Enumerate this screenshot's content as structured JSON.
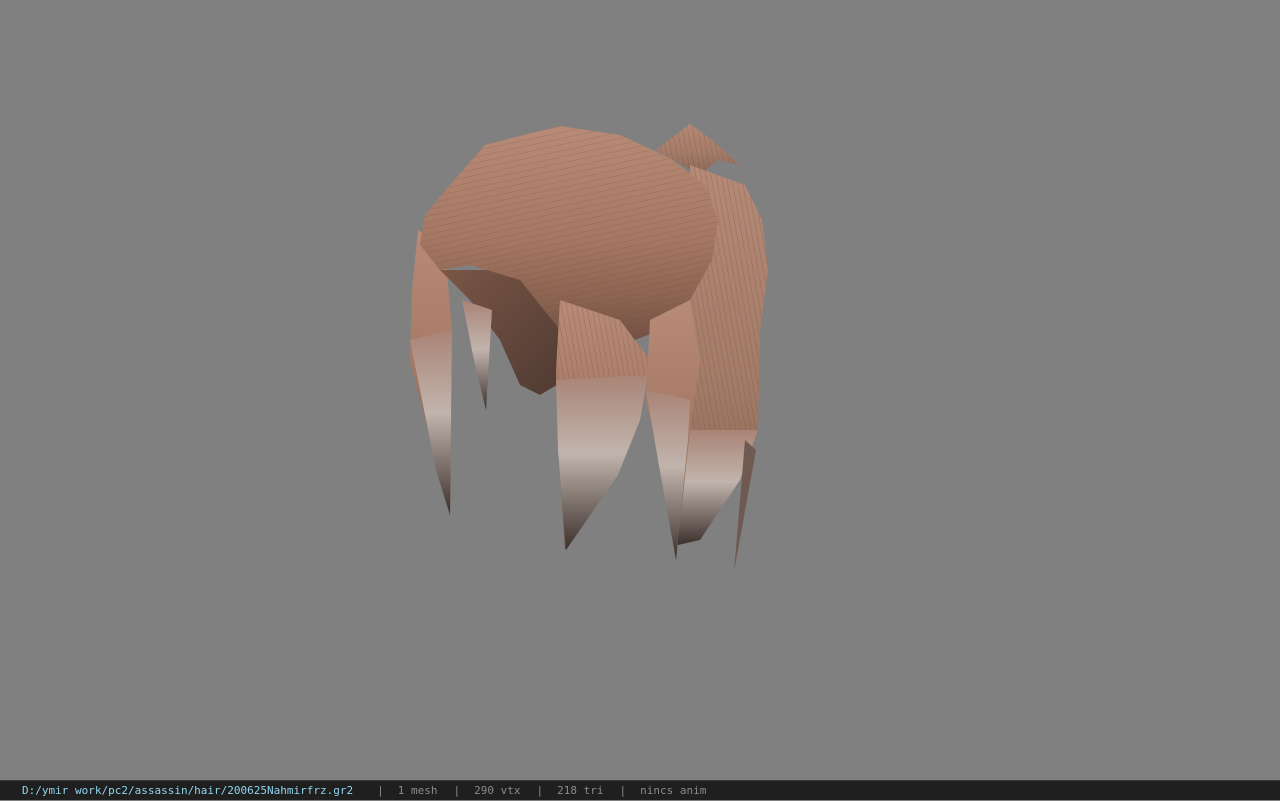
{
  "viewer": {
    "background_color": "#808080",
    "model": "hair-mesh",
    "hair_base_color": "#a57864",
    "hair_tip_color": "#b8aca6"
  },
  "statusbar": {
    "file_path": "D:/ymir work/pc2/assassin/hair/200625Nahmirfrz.gr2",
    "separator": "|",
    "mesh_count": "1 mesh",
    "vertex_count": "290 vtx",
    "triangle_count": "218 tri",
    "anim_status": "nincs anim",
    "path_color": "#8fd3ee",
    "text_color": "#8a8a8a"
  }
}
